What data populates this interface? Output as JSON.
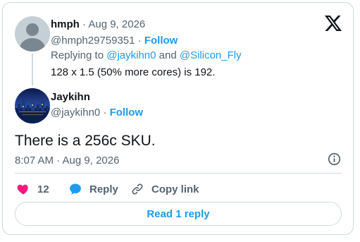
{
  "reply_tweet": {
    "author_name": "hmph",
    "date": "Aug 9, 2026",
    "handle": "@hmph29759351",
    "follow_label": "Follow",
    "replying_prefix": "Replying to",
    "replying_user1": "@jaykihn0",
    "replying_and": "and",
    "replying_user2": "@Silicon_Fly",
    "text": "128 x 1.5 (50% more cores) is 192."
  },
  "main_tweet": {
    "author_name": "Jaykihn",
    "handle": "@jaykihn0",
    "follow_label": "Follow",
    "text": "There is a 256c SKU.",
    "timestamp": "8:07 AM · Aug 9, 2026"
  },
  "actions": {
    "like_count": "12",
    "reply_label": "Reply",
    "copy_link_label": "Copy link"
  },
  "read_replies_label": "Read 1 reply",
  "colors": {
    "accent": "#1d9bf0",
    "like": "#f91880",
    "muted": "#536471",
    "border": "#cfd9de"
  },
  "icons": [
    "x-logo-icon",
    "info-icon",
    "heart-icon",
    "reply-bubble-icon",
    "link-icon"
  ]
}
